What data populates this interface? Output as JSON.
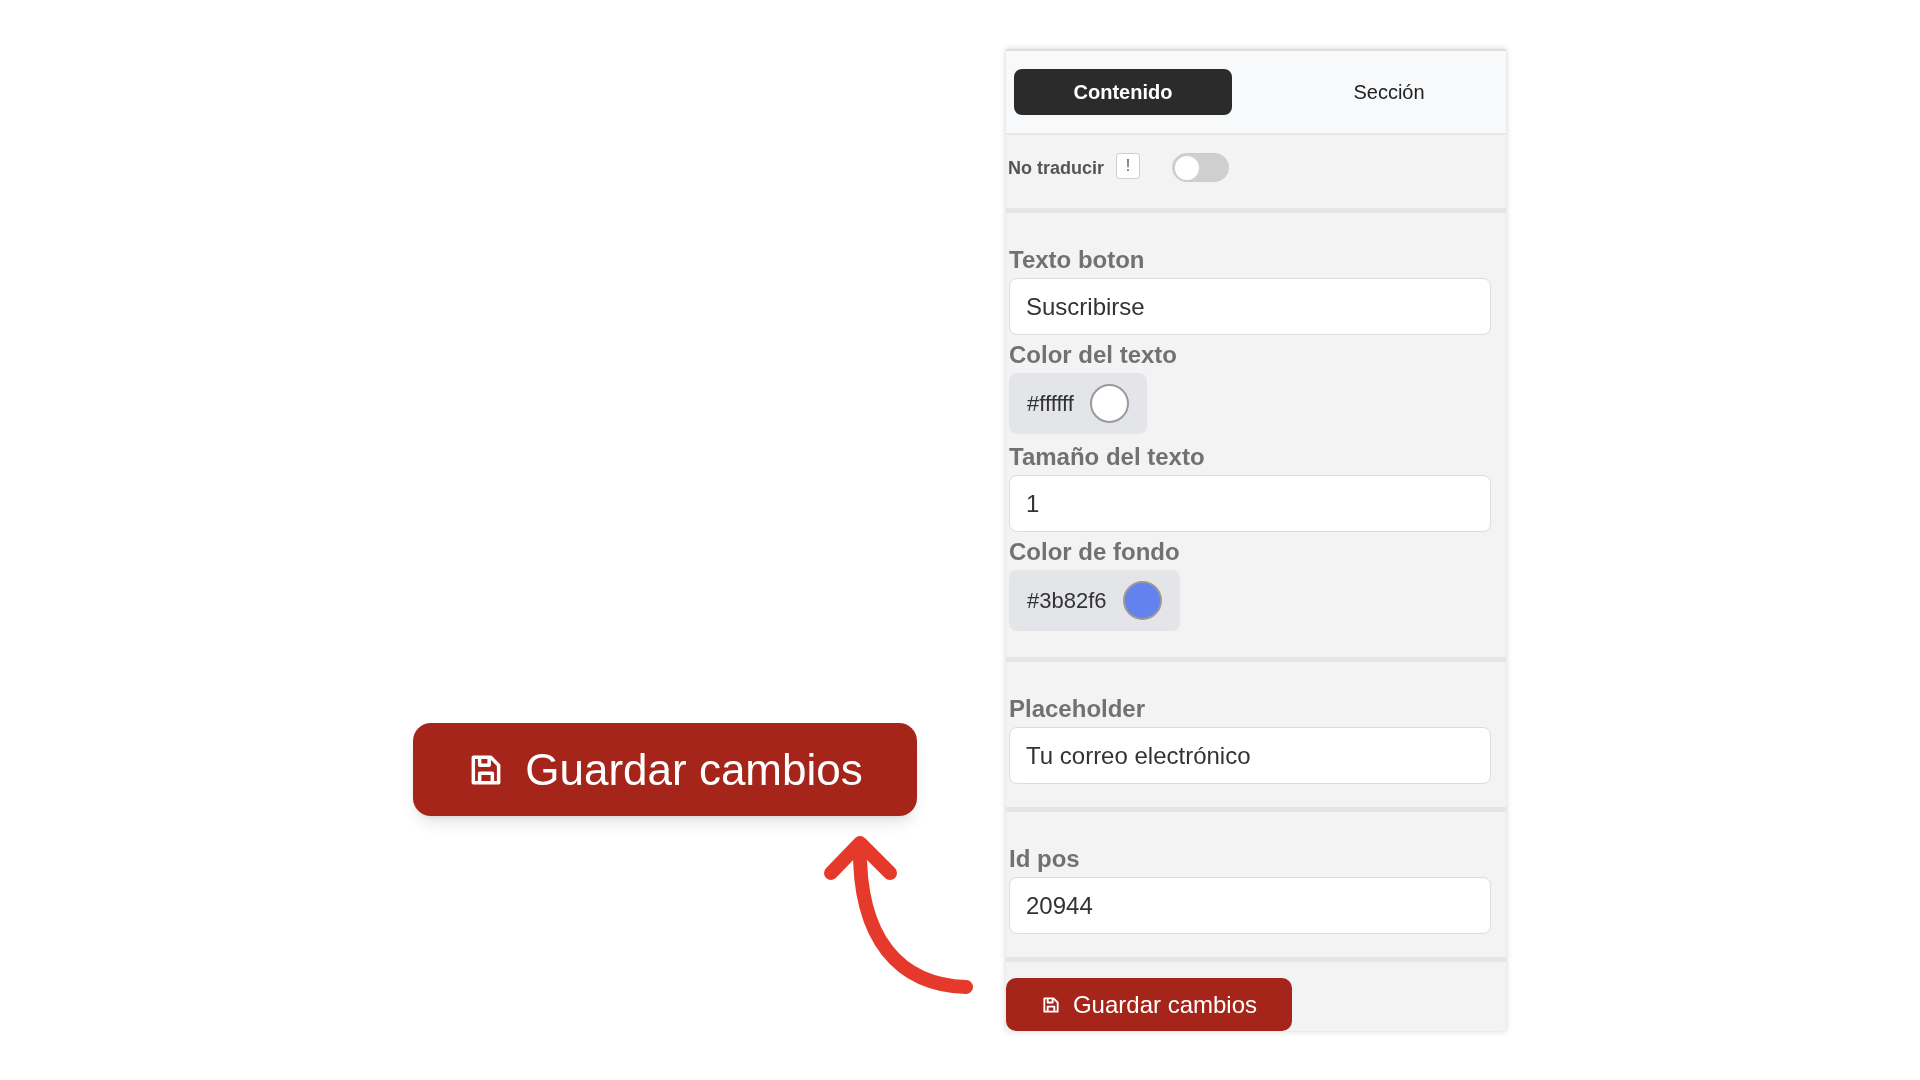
{
  "tabs": [
    {
      "label": "Contenido",
      "selected": true
    },
    {
      "label": "Sección",
      "selected": false
    }
  ],
  "no_translate": {
    "label": "No traducir",
    "info": "!",
    "on": false
  },
  "sections": [
    {
      "fields": [
        {
          "kind": "text",
          "label": "Texto boton",
          "value": "Suscribirse"
        },
        {
          "kind": "color",
          "label": "Color del texto",
          "value": "#ffffff",
          "color": "#ffffff"
        },
        {
          "kind": "text",
          "label": "Tamaño del texto",
          "value": "1"
        },
        {
          "kind": "color",
          "label": "Color de fondo",
          "value": "#3b82f6",
          "color": "#6382ed"
        }
      ]
    },
    {
      "fields": [
        {
          "kind": "text",
          "label": "Placeholder",
          "value": "Tu correo electrónico"
        }
      ]
    },
    {
      "fields": [
        {
          "kind": "text",
          "label": "Id pos",
          "value": "20944"
        }
      ]
    }
  ],
  "save_button": {
    "label": "Guardar cambios"
  },
  "callout": {
    "label": "Guardar cambios"
  }
}
